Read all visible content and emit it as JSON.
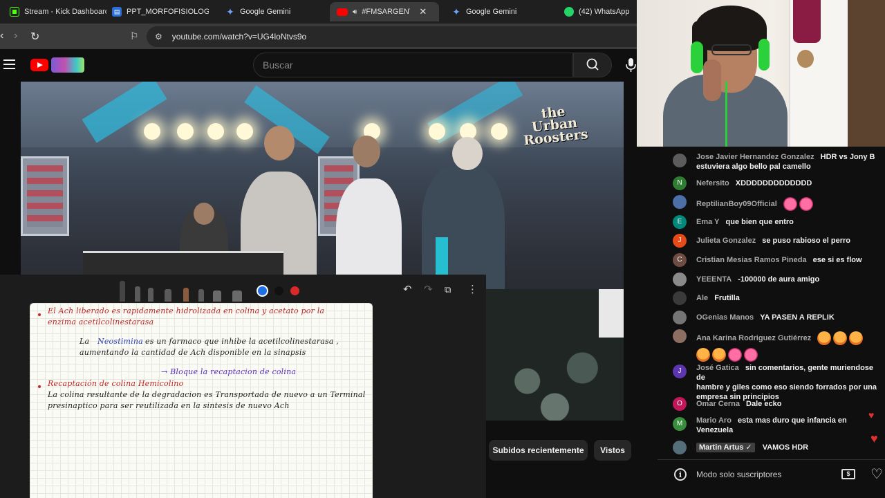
{
  "tabs": [
    {
      "label": "Stream - Kick Dashboard",
      "icon": "kick-icon"
    },
    {
      "label": "PPT_MORFOFISIOLOGÍA L",
      "icon": "slides-icon"
    },
    {
      "label": "Google Gemini",
      "icon": "gemini-icon"
    },
    {
      "label": "#FMSARGENTINA",
      "icon": "youtube-icon",
      "active": true
    },
    {
      "label": "Google Gemini",
      "icon": "gemini-icon"
    },
    {
      "label": "(42) WhatsApp",
      "icon": "whatsapp-icon"
    }
  ],
  "address": {
    "url": "youtube.com/watch?v=UG4loNtvs9o"
  },
  "youtube": {
    "search_placeholder": "Buscar",
    "chips": [
      "Subidos recientemente",
      "Vistos"
    ]
  },
  "video": {
    "brand_line1": "the Urban",
    "brand_line2": "Roosters"
  },
  "notes": {
    "colors": [
      "#1e6fe8",
      "#111111",
      "#d82a2a"
    ],
    "lines": [
      {
        "text": "El Ach liberado es rapidamente hidrolizada en colina y acetato por la",
        "color": "red"
      },
      {
        "text": "enzima acetilcolinestarasa",
        "color": "red"
      },
      {
        "text": "La",
        "color": "dark"
      },
      {
        "text": "Neostimina",
        "color": "blue"
      },
      {
        "text": "es un farmaco que inhibe la acetilcolinestarasa ,",
        "color": "dark"
      },
      {
        "text": "aumentando la cantidad de Ach disponible en la sinapsis",
        "color": "dark"
      },
      {
        "text": "→ Bloque la recaptacion de colina",
        "color": "purple"
      },
      {
        "text": "Recaptación de colina Hemicolino",
        "color": "red"
      },
      {
        "text": "La colina resultante de la degradacion es Transportada de nuevo a un Terminal",
        "color": "dark"
      },
      {
        "text": "presinaptico para ser reutilizada en la sintesis de nuevo Ach",
        "color": "dark"
      }
    ]
  },
  "chat": {
    "messages": [
      {
        "author": "Jose Javier Hernandez Gonzalez",
        "text": "HDR vs Jony B",
        "text2": "estuviera algo bello pal camello",
        "avatar_color": "#5c5c5c",
        "avatar_letter": ""
      },
      {
        "author": "Nefersito",
        "text": "XDDDDDDDDDDDDD",
        "avatar_color": "#2e7d32",
        "avatar_letter": "N"
      },
      {
        "author": "ReptilianBoy09Official",
        "text": "",
        "avatar_color": "#4d6fa8",
        "avatar_letter": ""
      },
      {
        "author": "Ema Y",
        "text": "que bien que entro",
        "avatar_color": "#00897b",
        "avatar_letter": "E"
      },
      {
        "author": "Julieta Gonzalez",
        "text": "se puso rabioso el perro",
        "avatar_color": "#e64a19",
        "avatar_letter": "J"
      },
      {
        "author": "Cristian Mesias Ramos Pineda",
        "text": "ese si es flow",
        "avatar_color": "#6d4c41",
        "avatar_letter": "C"
      },
      {
        "author": "YEEENTA",
        "text": "-100000 de aura amigo",
        "avatar_color": "#8a8a8a",
        "avatar_letter": ""
      },
      {
        "author": "Ale",
        "text": "Frutilla",
        "avatar_color": "#3a3a3a",
        "avatar_letter": ""
      },
      {
        "author": "OGenias Manos",
        "text": "YA PASEN A REPLIK",
        "avatar_color": "#757575",
        "avatar_letter": ""
      },
      {
        "author": "Ana Karina Rodriguez Gutiérrez",
        "text": "",
        "avatar_color": "#8d6e63",
        "avatar_letter": ""
      },
      {
        "author": "José Gatica",
        "text": "sin comentarios, gente muriendose de",
        "text2": "hambre y giles como eso siendo forrados por una",
        "text3": "empresa sin principios",
        "avatar_color": "#5e35b1",
        "avatar_letter": "J"
      },
      {
        "author": "Omar Cerna",
        "text": "Dale ecko",
        "avatar_color": "#c2185b",
        "avatar_letter": "O"
      },
      {
        "author": "Mario Aro",
        "text": "esta mas duro que infancia en",
        "text2": "Venezuela",
        "avatar_color": "#388e3c",
        "avatar_letter": "M"
      },
      {
        "author": "Martin Artus ✓",
        "text": "VAMOS HDR",
        "avatar_color": "#546e7a",
        "avatar_letter": ""
      }
    ],
    "footer_label": "Modo solo suscriptores"
  }
}
